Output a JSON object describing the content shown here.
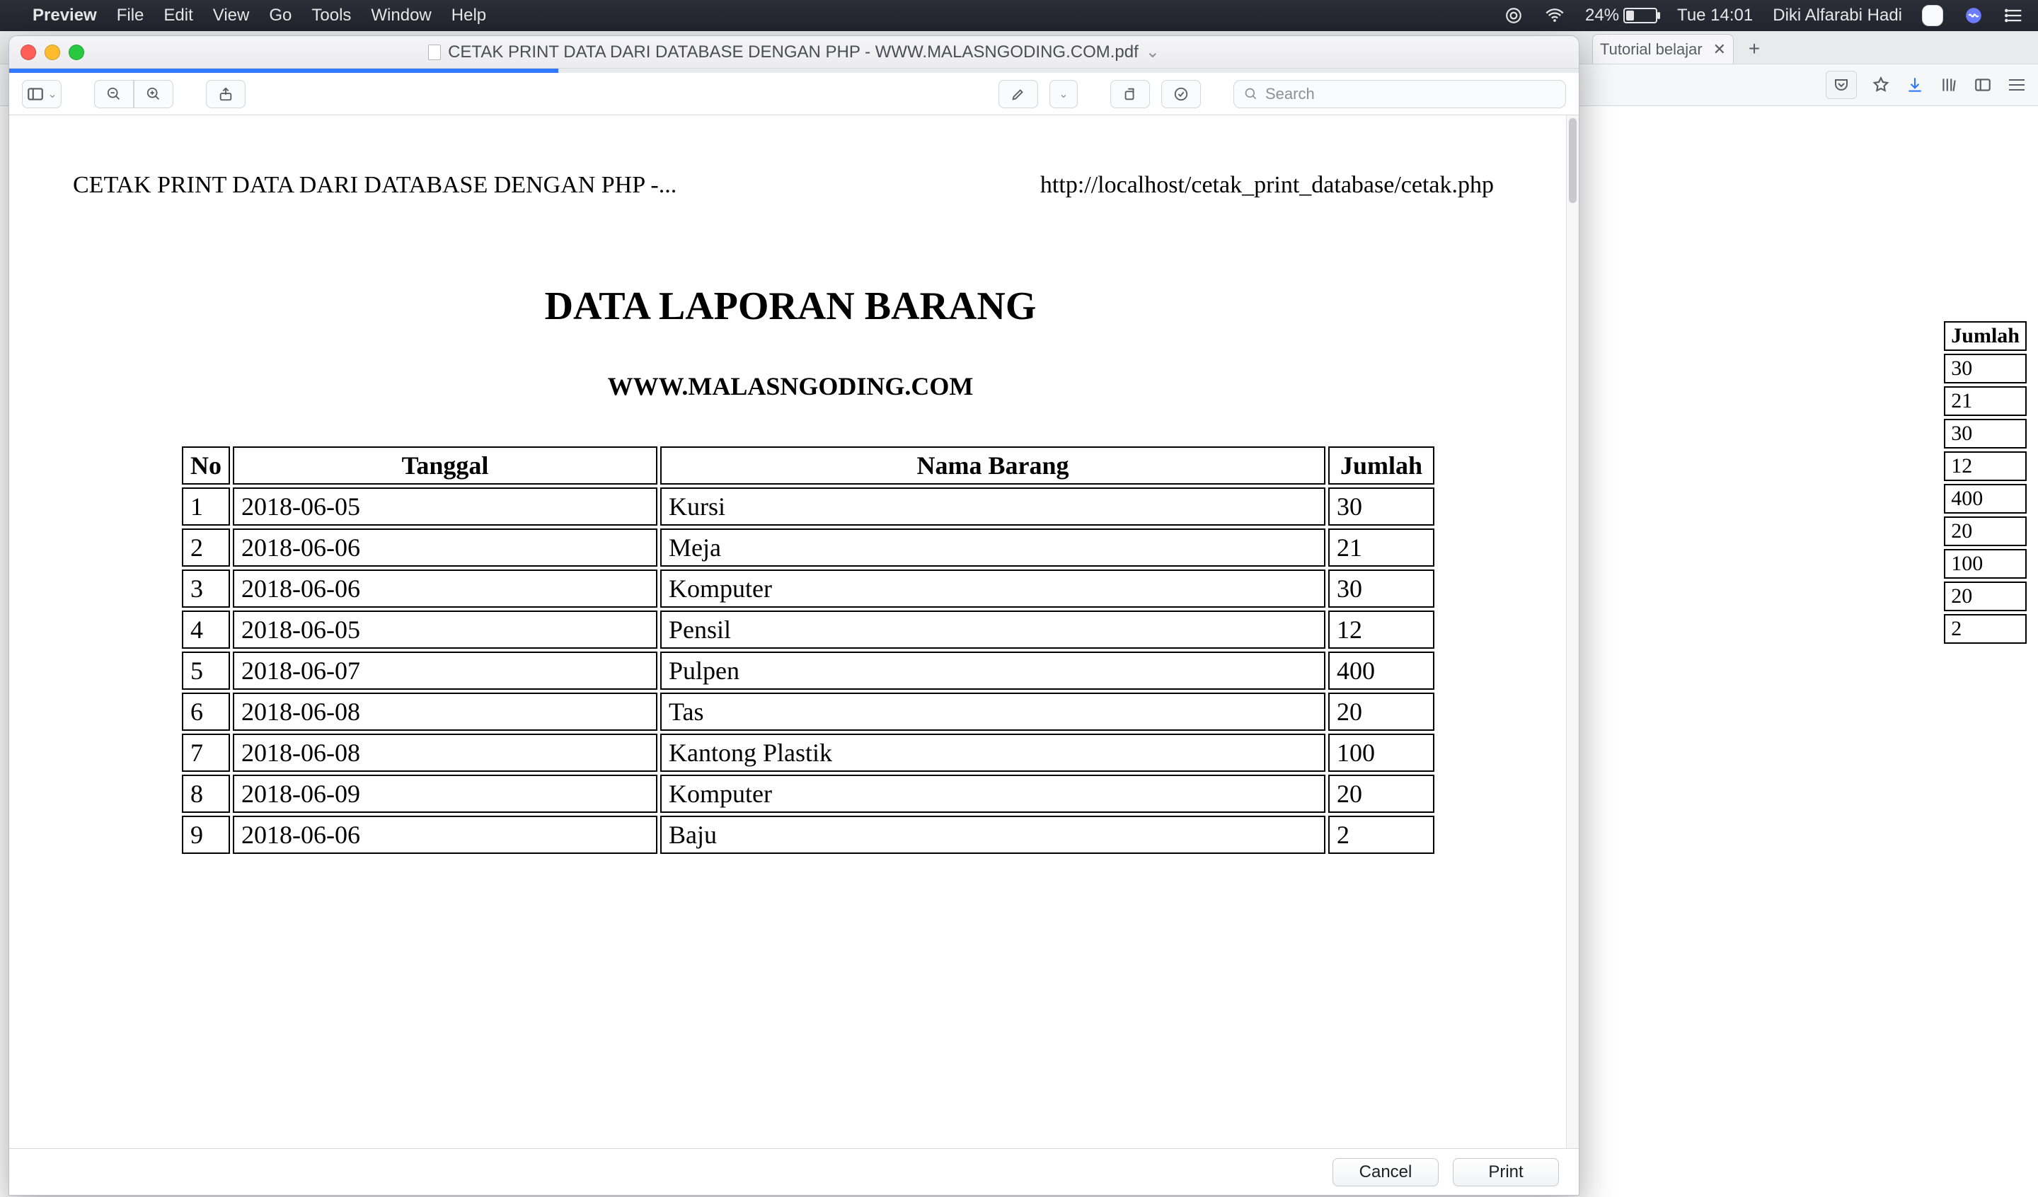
{
  "menubar": {
    "app_name": "Preview",
    "items": [
      "File",
      "Edit",
      "View",
      "Go",
      "Tools",
      "Window",
      "Help"
    ],
    "battery_pct": "24%",
    "clock": "Tue 14:01",
    "user": "Diki Alfarabi Hadi"
  },
  "browser": {
    "tab_title": "Tutorial belajar",
    "back_table": {
      "header": "Jumlah",
      "values": [
        "30",
        "21",
        "30",
        "12",
        "400",
        "20",
        "100",
        "20",
        "2"
      ]
    }
  },
  "preview": {
    "window_title": "CETAK PRINT DATA DARI DATABASE DENGAN PHP - WWW.MALASNGODING.COM.pdf",
    "search_placeholder": "Search",
    "page": {
      "left_header": "CETAK PRINT DATA DARI DATABASE DENGAN PHP -...",
      "right_header": "http://localhost/cetak_print_database/cetak.php",
      "title": "DATA LAPORAN BARANG",
      "subtitle": "WWW.MALASNGODING.COM",
      "columns": [
        "No",
        "Tanggal",
        "Nama Barang",
        "Jumlah"
      ],
      "rows": [
        {
          "no": "1",
          "tanggal": "2018-06-05",
          "nama": "Kursi",
          "jumlah": "30"
        },
        {
          "no": "2",
          "tanggal": "2018-06-06",
          "nama": "Meja",
          "jumlah": "21"
        },
        {
          "no": "3",
          "tanggal": "2018-06-06",
          "nama": "Komputer",
          "jumlah": "30"
        },
        {
          "no": "4",
          "tanggal": "2018-06-05",
          "nama": "Pensil",
          "jumlah": "12"
        },
        {
          "no": "5",
          "tanggal": "2018-06-07",
          "nama": "Pulpen",
          "jumlah": "400"
        },
        {
          "no": "6",
          "tanggal": "2018-06-08",
          "nama": "Tas",
          "jumlah": "20"
        },
        {
          "no": "7",
          "tanggal": "2018-06-08",
          "nama": "Kantong Plastik",
          "jumlah": "100"
        },
        {
          "no": "8",
          "tanggal": "2018-06-09",
          "nama": "Komputer",
          "jumlah": "20"
        },
        {
          "no": "9",
          "tanggal": "2018-06-06",
          "nama": "Baju",
          "jumlah": "2"
        }
      ]
    },
    "footer": {
      "cancel": "Cancel",
      "print": "Print"
    }
  }
}
